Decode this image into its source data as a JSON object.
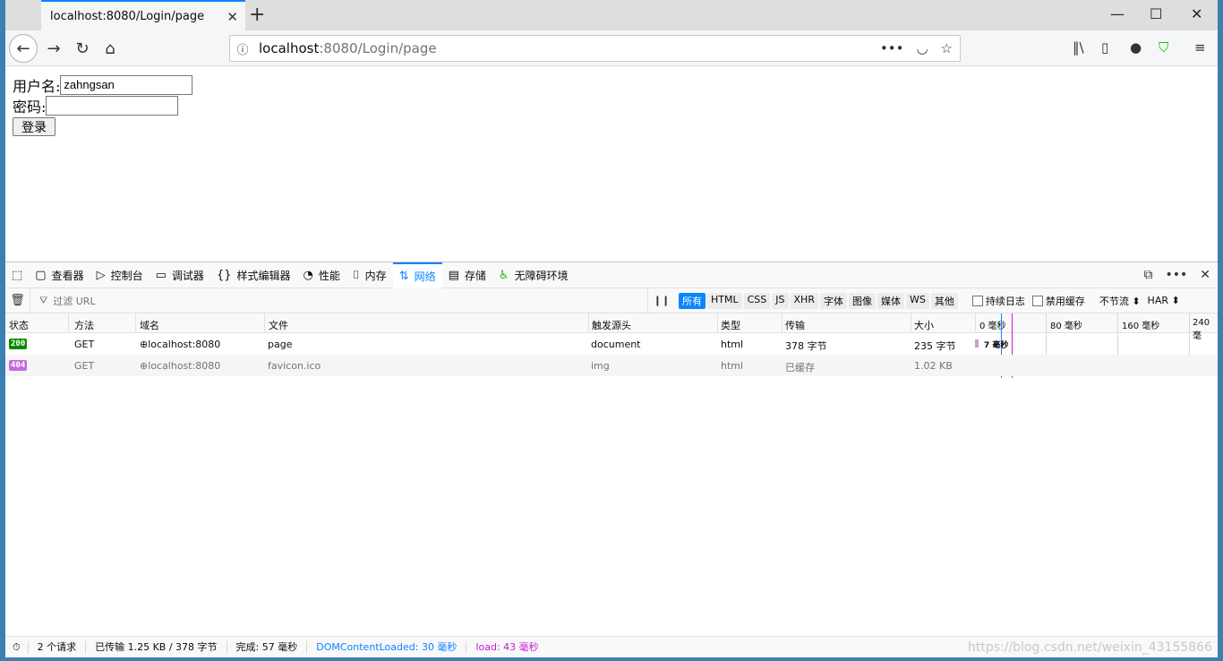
{
  "browser": {
    "tab_title": "localhost:8080/Login/page",
    "url_host": "localhost",
    "url_rest": ":8080/Login/page"
  },
  "form": {
    "username_label": "用户名:",
    "username_value": "zahngsan",
    "password_label": "密码:",
    "password_value": "",
    "login_label": "登录"
  },
  "devtools": {
    "tabs": [
      "查看器",
      "控制台",
      "调试器",
      "样式编辑器",
      "性能",
      "内存",
      "网络",
      "存储",
      "无障碍环境"
    ],
    "active_tab": "网络",
    "filter_placeholder": "过滤 URL",
    "type_filters": [
      "所有",
      "HTML",
      "CSS",
      "JS",
      "XHR",
      "字体",
      "图像",
      "媒体",
      "WS",
      "其他"
    ],
    "persist_log": "持续日志",
    "disable_cache": "禁用缓存",
    "throttle": "不节流 ⬍",
    "har": "HAR ⬍"
  },
  "network": {
    "columns": [
      "状态",
      "方法",
      "域名",
      "文件",
      "触发源头",
      "类型",
      "传输",
      "大小"
    ],
    "waterfall_labels": [
      "0 毫秒",
      "80 毫秒",
      "160 毫秒",
      "240 毫"
    ],
    "rows": [
      {
        "status": "200",
        "status_color": "#058b00",
        "method": "GET",
        "domain": "localhost:8080",
        "file": "page",
        "cause": "document",
        "type": "html",
        "transferred": "378 字节",
        "size": "235 字节",
        "timing": "7 毫秒"
      },
      {
        "status": "404",
        "status_color": "#c46bde",
        "method": "GET",
        "domain": "localhost:8080",
        "file": "favicon.ico",
        "cause": "img",
        "type": "html",
        "transferred": "已缓存",
        "size": "1.02 KB",
        "timing": ""
      }
    ]
  },
  "statusbar": {
    "requests": "2 个请求",
    "transferred": "已传输 1.25 KB / 378 字节",
    "finish": "完成: 57 毫秒",
    "dom_loaded": "DOMContentLoaded: 30 毫秒",
    "load": "load: 43 毫秒",
    "watermark": "https://blog.csdn.net/weixin_43155866"
  }
}
